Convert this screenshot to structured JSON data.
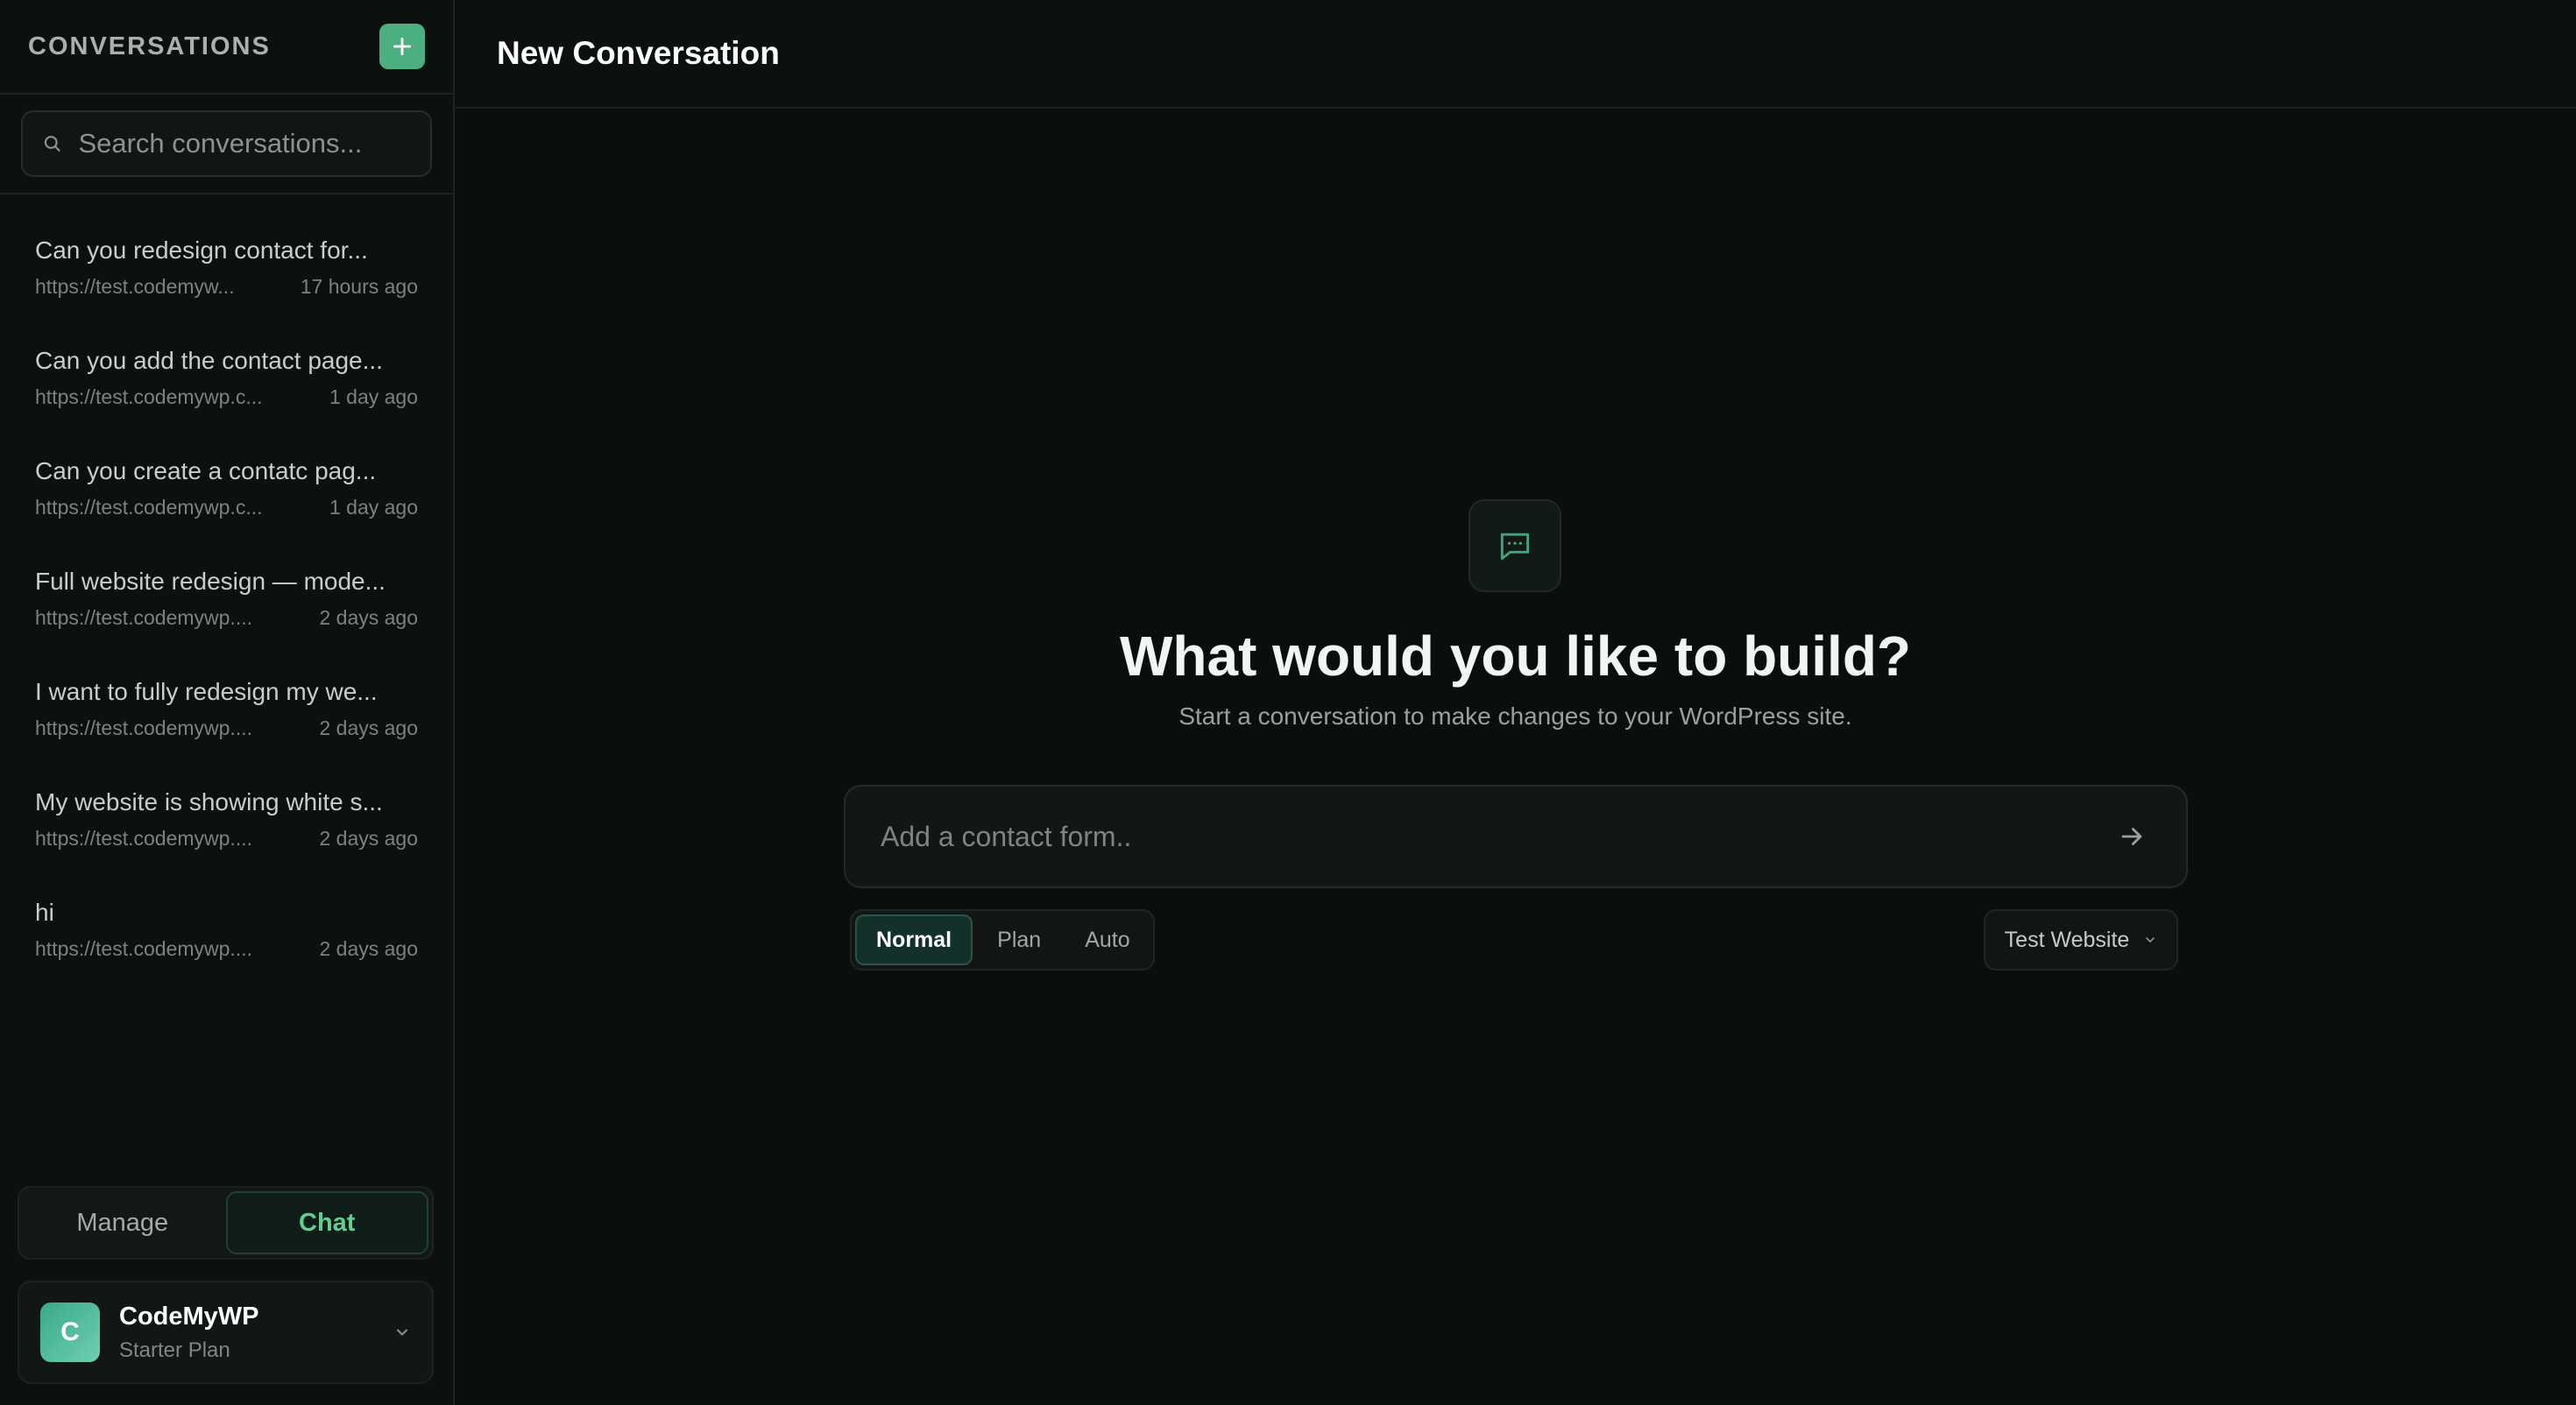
{
  "sidebar": {
    "title": "CONVERSATIONS",
    "new_button_icon": "plus-icon",
    "search": {
      "placeholder": "Search conversations...",
      "value": ""
    },
    "conversations": [
      {
        "title": "Can you redesign contact for...",
        "url": "https://test.codemyw...",
        "time": "17 hours ago"
      },
      {
        "title": "Can you add the contact page...",
        "url": "https://test.codemywp.c...",
        "time": "1 day ago"
      },
      {
        "title": "Can you create a contatc pag...",
        "url": "https://test.codemywp.c...",
        "time": "1 day ago"
      },
      {
        "title": "Full website redesign — mode...",
        "url": "https://test.codemywp....",
        "time": "2 days ago"
      },
      {
        "title": "I want to fully redesign my we...",
        "url": "https://test.codemywp....",
        "time": "2 days ago"
      },
      {
        "title": "My website is showing white s...",
        "url": "https://test.codemywp....",
        "time": "2 days ago"
      },
      {
        "title": "hi",
        "url": "https://test.codemywp....",
        "time": "2 days ago"
      }
    ],
    "toggle": {
      "manage": "Manage",
      "chat": "Chat",
      "active": "chat"
    },
    "account": {
      "initial": "C",
      "name": "CodeMyWP",
      "plan": "Starter Plan"
    }
  },
  "main": {
    "title": "New Conversation",
    "headline": "What would you like to build?",
    "subline": "Start a conversation to make changes to your WordPress site.",
    "prompt": {
      "placeholder": "Add a contact form..",
      "value": ""
    },
    "modes": {
      "normal": "Normal",
      "plan": "Plan",
      "auto": "Auto",
      "active": "normal"
    },
    "site_select": "Test Website"
  },
  "colors": {
    "accent": "#4caf7f",
    "background": "#0a0e0d"
  }
}
